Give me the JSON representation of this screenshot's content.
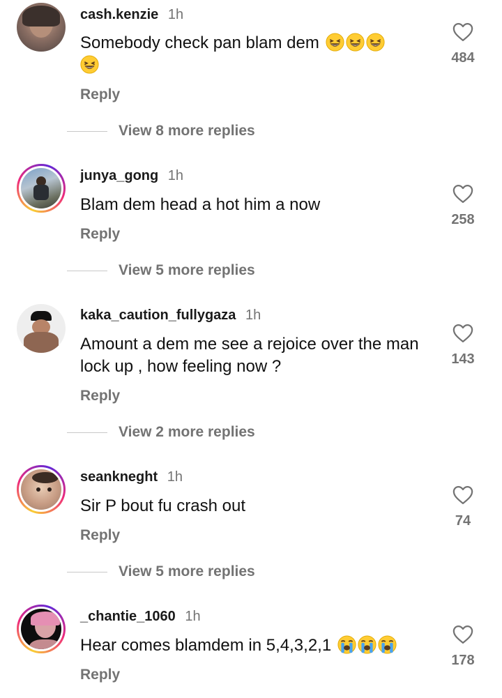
{
  "comments": [
    {
      "username": "cash.kenzie",
      "time": "1h",
      "text": "Somebody check pan  blam dem",
      "emoji": "grinning-squint-emoji",
      "emoji_count": 4,
      "reply_label": "Reply",
      "more_replies": "View 8 more replies",
      "likes": "484",
      "avatar_ring": false
    },
    {
      "username": "junya_gong",
      "time": "1h",
      "text": "Blam dem head a hot him a now",
      "reply_label": "Reply",
      "more_replies": "View 5 more replies",
      "likes": "258",
      "avatar_ring": true
    },
    {
      "username": "kaka_caution_fullygaza",
      "time": "1h",
      "text": "Amount a dem me see a rejoice over the man lock up , how feeling now ?",
      "reply_label": "Reply",
      "more_replies": "View 2 more replies",
      "likes": "143",
      "avatar_ring": false
    },
    {
      "username": "seankneght",
      "time": "1h",
      "text": "Sir P bout fu crash out",
      "reply_label": "Reply",
      "more_replies": "View 5 more replies",
      "likes": "74",
      "avatar_ring": true
    },
    {
      "username": "_chantie_1060",
      "time": "1h",
      "text": "Hear comes blamdem in 5,4,3,2,1",
      "emoji": "loudly-crying-emoji",
      "emoji_count": 3,
      "reply_label": "Reply",
      "likes": "178",
      "avatar_ring": true
    }
  ],
  "icons": {
    "like": "heart-outline-icon"
  },
  "colors": {
    "text": "#111111",
    "muted": "#737373",
    "ring_start": "#f9ce34",
    "ring_mid": "#ee2a7b"
  }
}
